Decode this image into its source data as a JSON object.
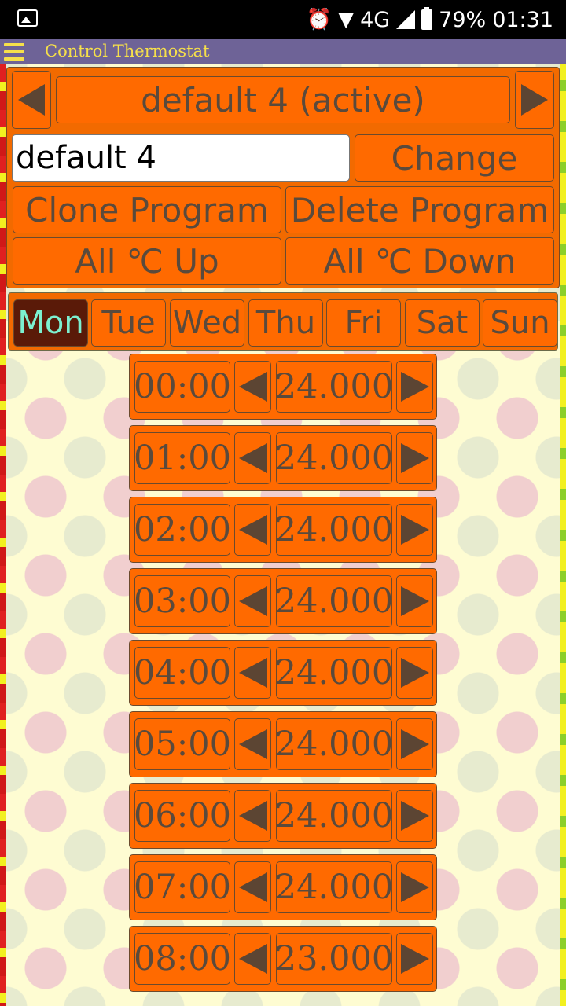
{
  "status_bar": {
    "left_icon": "gallery-icon",
    "network": "4G",
    "battery": "79%",
    "time": "01:31"
  },
  "app": {
    "title": "Control Thermostat"
  },
  "program": {
    "title": "default 4 (active)",
    "name_value": "default 4",
    "change_label": "Change",
    "clone_label": "Clone Program",
    "delete_label": "Delete Program",
    "all_up_label": "All ℃ Up",
    "all_down_label": "All ℃ Down"
  },
  "days": [
    "Mon",
    "Tue",
    "Wed",
    "Thu",
    "Fri",
    "Sat",
    "Sun"
  ],
  "selected_day": "Mon",
  "schedule": [
    {
      "time": "00:00",
      "temp": "24.000"
    },
    {
      "time": "01:00",
      "temp": "24.000"
    },
    {
      "time": "02:00",
      "temp": "24.000"
    },
    {
      "time": "03:00",
      "temp": "24.000"
    },
    {
      "time": "04:00",
      "temp": "24.000"
    },
    {
      "time": "05:00",
      "temp": "24.000"
    },
    {
      "time": "06:00",
      "temp": "24.000"
    },
    {
      "time": "07:00",
      "temp": "24.000"
    },
    {
      "time": "08:00",
      "temp": "23.000"
    }
  ],
  "colors": {
    "accent": "#ff6a00",
    "active_day_bg": "#5a1a08",
    "active_day_text": "#7cf0d0",
    "title_bar": "#6e6397",
    "title_text": "#f6e04a"
  }
}
